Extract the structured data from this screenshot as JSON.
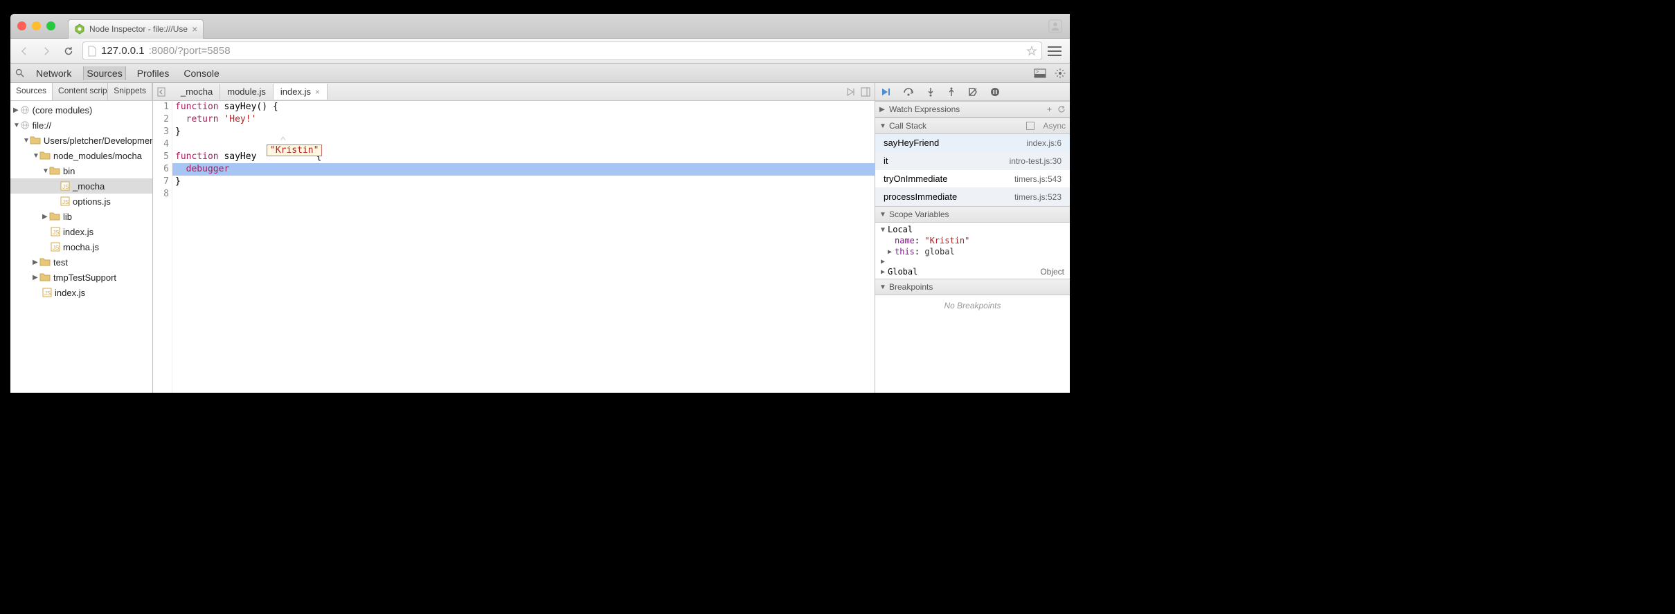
{
  "browser": {
    "tab_title": "Node Inspector - file:///Use",
    "url_host": "127.0.0.1",
    "url_path": ":8080/?port=5858"
  },
  "devtools_tabs": [
    "Network",
    "Sources",
    "Profiles",
    "Console"
  ],
  "devtools_active_tab": "Sources",
  "left_tabs": [
    "Sources",
    "Content scrip…",
    "Snippets"
  ],
  "tree": {
    "core": "(core modules)",
    "root": "file://",
    "path": "Users/pletcher/Development/",
    "nm": "node_modules/mocha",
    "bin": "bin",
    "mocha": "_mocha",
    "options": "options.js",
    "lib": "lib",
    "indexjs": "index.js",
    "mochajs": "mocha.js",
    "test": "test",
    "tmp": "tmpTestSupport",
    "root_index": "index.js"
  },
  "file_tabs": [
    "_mocha",
    "module.js",
    "index.js"
  ],
  "code": {
    "l1a": "function",
    "l1b": " sayHey() {",
    "l2a": "  return",
    "l2b": " 'Hey!'",
    "l3": "}",
    "l4": "",
    "l5a": "function",
    "l5b": " sayHey",
    "l5c": "           {",
    "l6": "  debugger",
    "l7": "}",
    "l8": "",
    "tooltip": "\"Kristin\""
  },
  "right": {
    "watch": "Watch Expressions",
    "callstack": "Call Stack",
    "async": "Async",
    "stack": [
      {
        "fn": "sayHeyFriend",
        "loc": "index.js:6"
      },
      {
        "fn": "it",
        "loc": "intro-test.js:30"
      },
      {
        "fn": "tryOnImmediate",
        "loc": "timers.js:543"
      },
      {
        "fn": "processImmediate",
        "loc": "timers.js:523"
      }
    ],
    "scope": "Scope Variables",
    "local": "Local",
    "name_key": "name",
    "name_val": "\"Kristin\"",
    "this_key": "this",
    "this_val": "global",
    "global": "Global",
    "global_type": "Object",
    "breakpoints": "Breakpoints",
    "no_bp": "No Breakpoints"
  }
}
